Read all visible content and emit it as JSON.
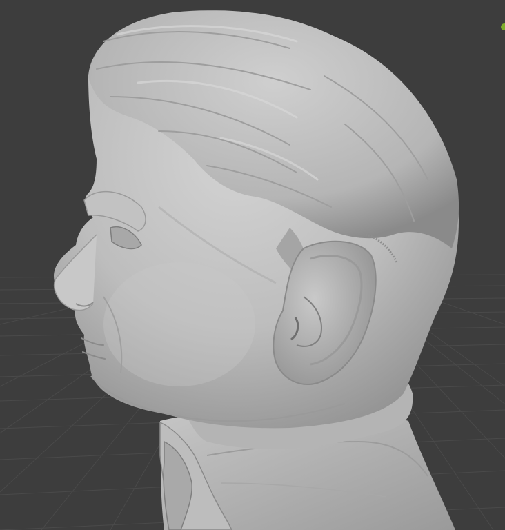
{
  "viewport": {
    "background_color": "#3d3d3d",
    "grid_color": "#4a4a4a",
    "grid_fine_color": "#444444",
    "sculpt_base_color": "#bcbcbc",
    "sculpt_shadow_color": "#8f8f8f",
    "sculpt_highlight_color": "#d6d6d6",
    "object": "sculpted-head-bust",
    "gizmo_accent_color": "#7fae2c"
  },
  "status": {
    "text": ""
  }
}
